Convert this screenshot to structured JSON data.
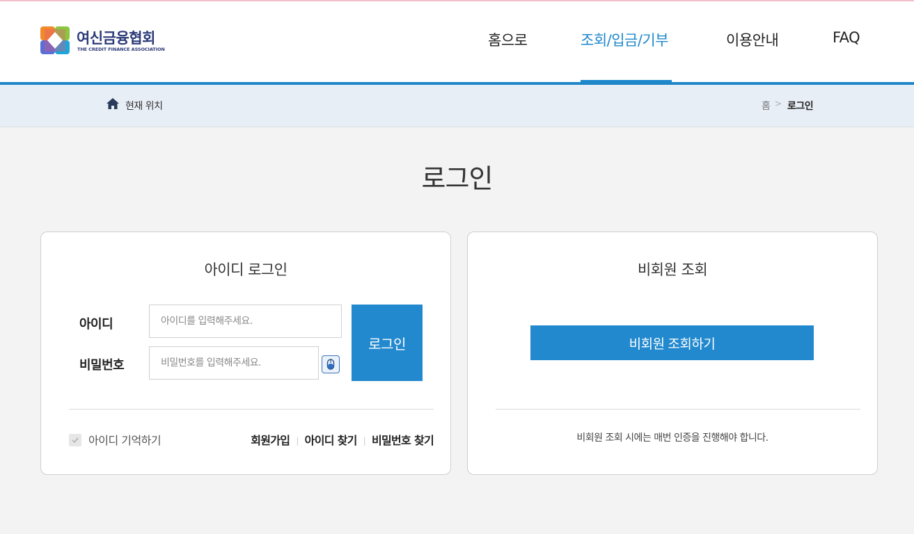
{
  "header": {
    "logo_name": "여신금융협회",
    "logo_sub": "THE CREDIT FINANCE ASSOCIATION",
    "nav": [
      {
        "label": "홈으로",
        "active": false
      },
      {
        "label": "조회/입금/기부",
        "active": true
      },
      {
        "label": "이용안내",
        "active": false
      },
      {
        "label": "FAQ",
        "active": false
      }
    ],
    "accent_color": "#1e88cc"
  },
  "location": {
    "label": "현재 위치",
    "icon": "home-icon",
    "breadcrumb": [
      "홈",
      "로그인"
    ],
    "separator": ">"
  },
  "page": {
    "title": "로그인"
  },
  "id_login": {
    "title": "아이디 로그인",
    "id_label": "아이디",
    "id_placeholder": "아이디를 입력해주세요.",
    "pw_label": "비밀번호",
    "pw_placeholder": "비밀번호를 입력해주세요.",
    "keyboard_icon": "virtual-keyboard-icon",
    "login_button": "로그인",
    "remember_label": "아이디 기억하기",
    "remember_checked": false,
    "links": [
      "회원가입",
      "아이디 찾기",
      "비밀번호 찾기"
    ]
  },
  "guest": {
    "title": "비회원 조회",
    "button": "비회원 조회하기",
    "note": "비회원 조회 시에는 매번 인증을 진행해야 합니다."
  }
}
